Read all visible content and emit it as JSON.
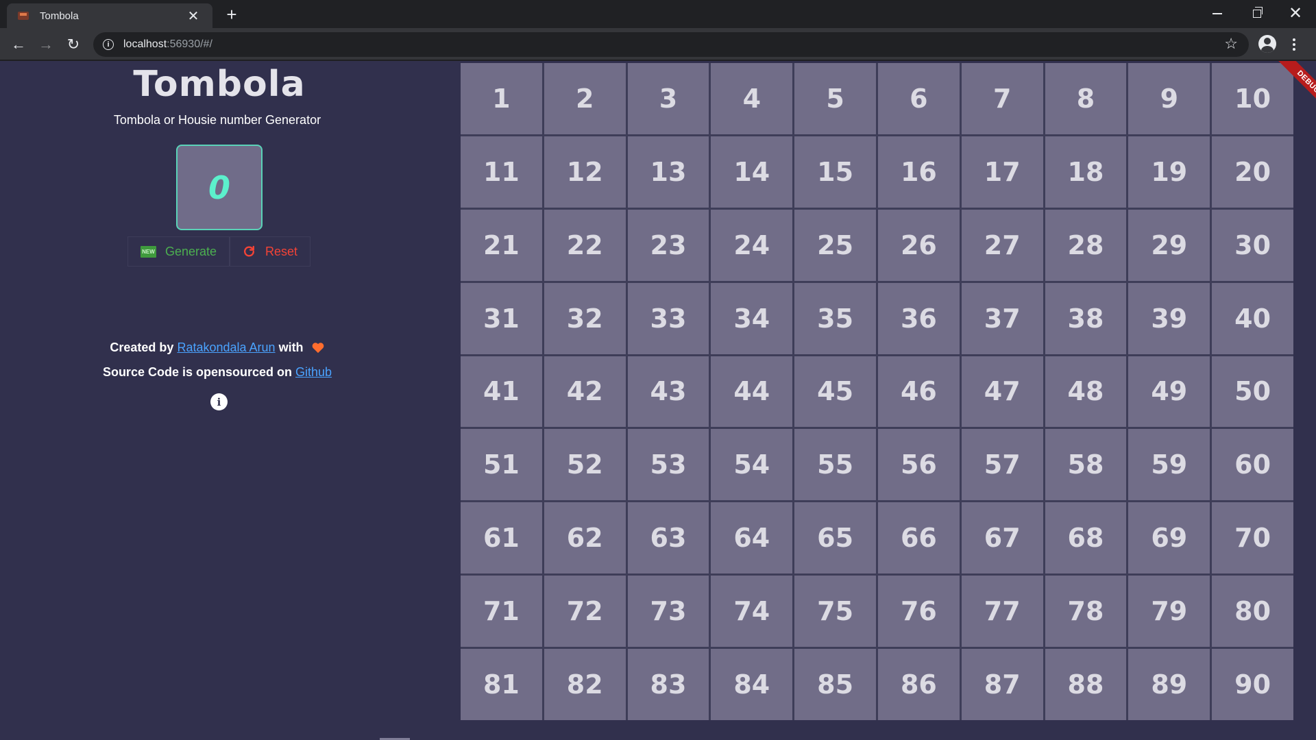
{
  "browser": {
    "tab_title": "Tombola",
    "tab_close": "✕",
    "new_tab": "+",
    "url_host": "localhost",
    "url_rest": ":56930/#/",
    "star": "☆",
    "back": "←",
    "forward": "→",
    "reload": "↻",
    "close": "✕"
  },
  "app": {
    "title": "Tombola",
    "subtitle": "Tombola or Housie number Generator",
    "current_number": "0",
    "generate_icon_text": "NEW",
    "generate_label": "Generate",
    "reset_label": "Reset",
    "credit_prefix": "Created by ",
    "credit_author": "Ratakondala Arun",
    "credit_suffix": " with",
    "source_prefix": "Source Code is opensourced on ",
    "source_link": "Github",
    "info_icon": "i",
    "debug_label": "DEBUG"
  },
  "grid": {
    "numbers": [
      "1",
      "2",
      "3",
      "4",
      "5",
      "6",
      "7",
      "8",
      "9",
      "10",
      "11",
      "12",
      "13",
      "14",
      "15",
      "16",
      "17",
      "18",
      "19",
      "20",
      "21",
      "22",
      "23",
      "24",
      "25",
      "26",
      "27",
      "28",
      "29",
      "30",
      "31",
      "32",
      "33",
      "34",
      "35",
      "36",
      "37",
      "38",
      "39",
      "40",
      "41",
      "42",
      "43",
      "44",
      "45",
      "46",
      "47",
      "48",
      "49",
      "50",
      "51",
      "52",
      "53",
      "54",
      "55",
      "56",
      "57",
      "58",
      "59",
      "60",
      "61",
      "62",
      "63",
      "64",
      "65",
      "66",
      "67",
      "68",
      "69",
      "70",
      "71",
      "72",
      "73",
      "74",
      "75",
      "76",
      "77",
      "78",
      "79",
      "80",
      "81",
      "82",
      "83",
      "84",
      "85",
      "86",
      "87",
      "88",
      "89",
      "90"
    ]
  },
  "colors": {
    "accent_generate": "#4caf50",
    "accent_reset": "#f44336",
    "number_color": "#5cf0cc",
    "link_color": "#4aa3ff",
    "heart_color": "#ff6d2e"
  }
}
